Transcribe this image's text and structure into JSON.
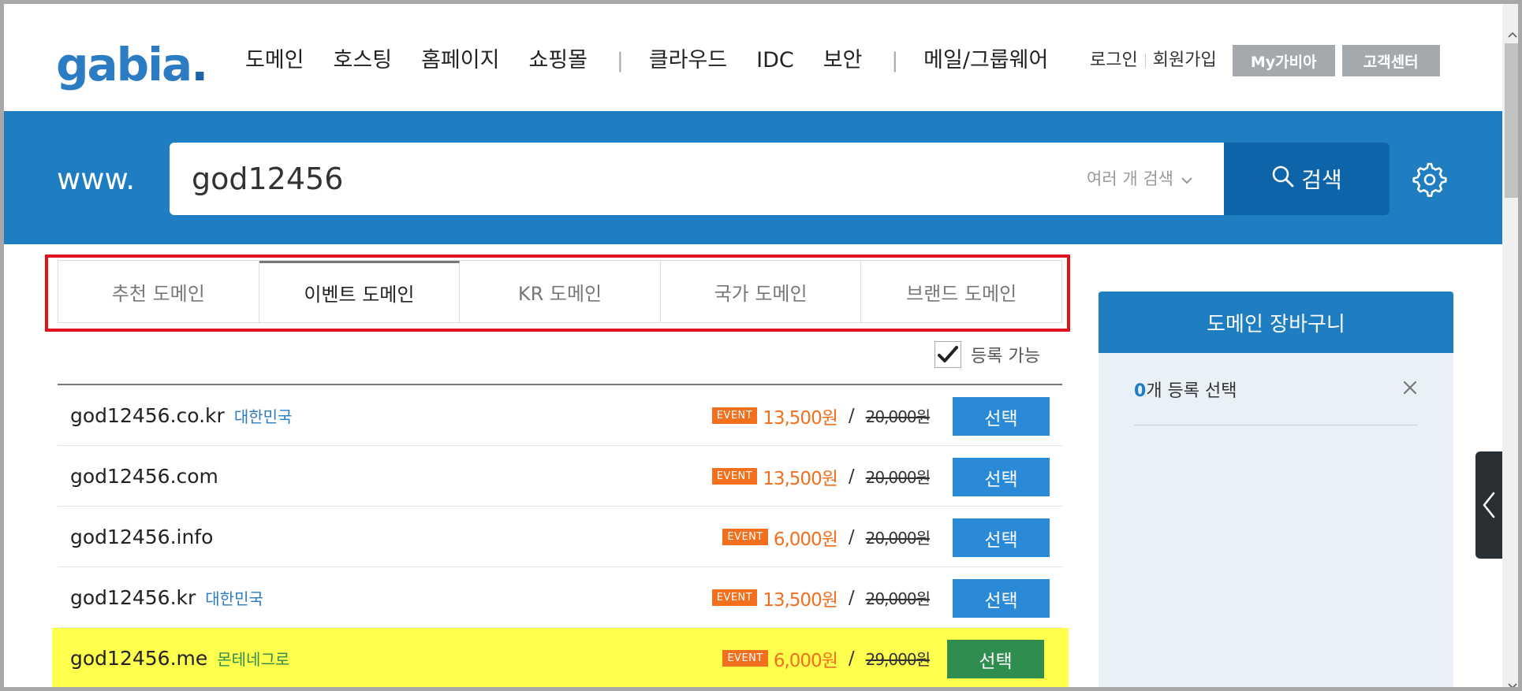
{
  "header": {
    "logo": "gabia",
    "logo_dot": ".",
    "gnb": [
      "도메인",
      "호스팅",
      "홈페이지",
      "쇼핑몰",
      "클라우드",
      "IDC",
      "보안",
      "메일/그룹웨어"
    ],
    "separator": "|",
    "login": "로그인",
    "signup": "회원가입",
    "my_btn": "My가비아",
    "cs_btn": "고객센터"
  },
  "search": {
    "prefix": "www.",
    "query": "god12456",
    "multi_label": "여러 개 검색",
    "button_label": "검색"
  },
  "tabs": [
    {
      "label": "추천 도메인",
      "active": false
    },
    {
      "label": "이벤트 도메인",
      "active": true
    },
    {
      "label": "KR 도메인",
      "active": false
    },
    {
      "label": "국가 도메인",
      "active": false
    },
    {
      "label": "브랜드 도메인",
      "active": false
    }
  ],
  "filter": {
    "label": "등록 가능",
    "checked": true
  },
  "results": [
    {
      "domain": "god12456.co.kr",
      "country": "대한민국",
      "badge": "EVENT",
      "sale": "13,500원",
      "slash": "/",
      "original": "20,000원",
      "button": "선택"
    },
    {
      "domain": "god12456.com",
      "country": "",
      "badge": "EVENT",
      "sale": "13,500원",
      "slash": "/",
      "original": "20,000원",
      "button": "선택"
    },
    {
      "domain": "god12456.info",
      "country": "",
      "badge": "EVENT",
      "sale": "6,000원",
      "slash": "/",
      "original": "20,000원",
      "button": "선택"
    },
    {
      "domain": "god12456.kr",
      "country": "대한민국",
      "badge": "EVENT",
      "sale": "13,500원",
      "slash": "/",
      "original": "20,000원",
      "button": "선택"
    },
    {
      "domain": "god12456.me",
      "country": "몬테네그로",
      "badge": "EVENT",
      "sale": "6,000원",
      "slash": "/",
      "original": "29,000원",
      "button": "선택"
    }
  ],
  "cart": {
    "title": "도메인 장바구니",
    "count": "0",
    "count_suffix": "개 등록 선택"
  },
  "colors": {
    "brand_blue": "#1e7ec1",
    "search_button": "#0e64a8",
    "event_orange": "#f26f1e",
    "select_blue": "#2b8ad7",
    "select_green": "#2e8d4f",
    "highlight_yellow": "#ffff4d",
    "outline_red": "#e4131b"
  },
  "icons": [
    "search-icon",
    "gear-icon",
    "chevron-down-icon",
    "checkmark-icon",
    "close-icon",
    "chevron-left-icon"
  ]
}
